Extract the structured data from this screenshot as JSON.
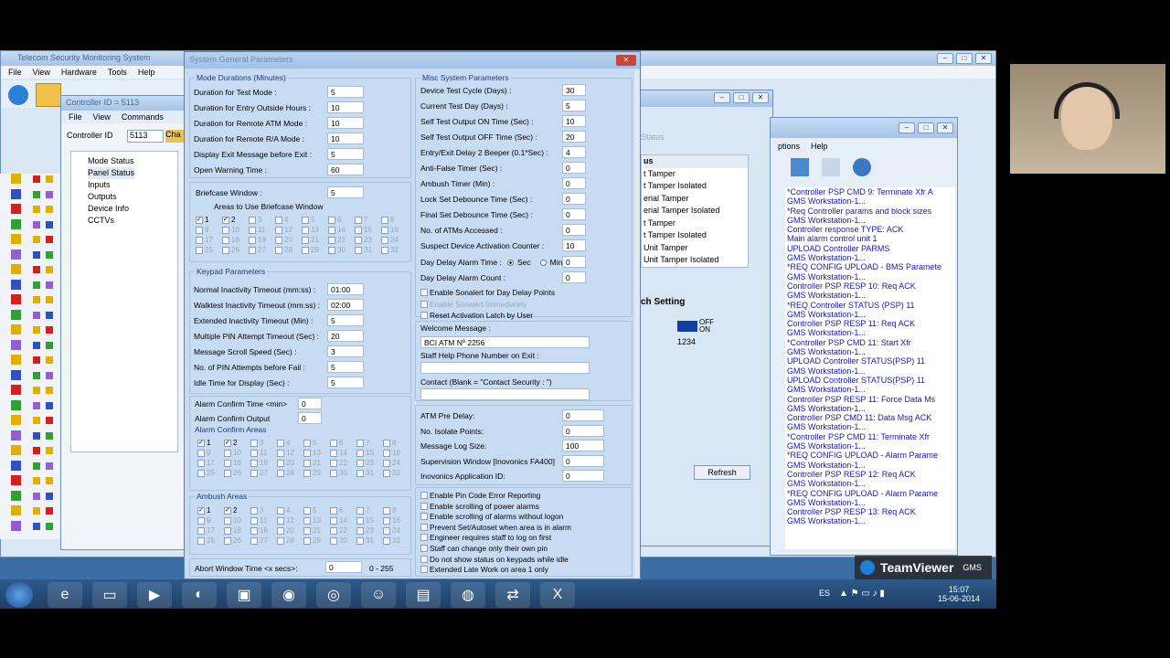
{
  "bg_window": {
    "title": "Telecom Security Monitoring System",
    "menu": [
      "File",
      "View",
      "Hardware",
      "Tools",
      "Help"
    ]
  },
  "controller_window": {
    "title": "Controller ID = 5113",
    "menu": [
      "File",
      "View",
      "Commands"
    ],
    "controller_id_label": "Controller ID",
    "controller_id_value": "5113",
    "cha_button": "Cha",
    "tree": [
      "Mode Status",
      "Panel Status",
      "Inputs",
      "Outputs",
      "Device Info",
      "CCTVs"
    ]
  },
  "status_window": {
    "status_label": "Status",
    "menu": [
      "ptions",
      "Help"
    ],
    "list_header": "us",
    "items": [
      "t Tamper",
      "t Tamper Isolated",
      "erial Tamper",
      "erial Tamper Isolated",
      "t Tamper",
      "t Tamper Isolated",
      "Unit Tamper",
      "Unit Tamper Isolated"
    ],
    "switch_title": "ch Setting",
    "switch_off": "OFF",
    "switch_on": "ON",
    "switch_code": "1234",
    "refresh": "Refresh"
  },
  "log_lines": [
    "*Controller PSP CMD 9: Terminate Xfr A",
    "GMS Workstation-1...",
    "*Req Controller params and block sizes",
    "GMS Workstation-1...",
    "Controller response  TYPE: ACK",
    "Main alarm control unit 1",
    "UPLOAD Controller PARMS",
    "GMS Workstation-1...",
    "*REQ CONFIG UPLOAD - BMS Paramete",
    "GMS Workstation-1...",
    "Controller PSP RESP 10: Req ACK",
    "GMS Workstation-1...",
    "*REQ Controller STATUS (PSP) 11",
    "GMS Workstation-1...",
    "Controller PSP RESP 11: Req ACK",
    "GMS Workstation-1...",
    "*Controller PSP CMD 11: Start Xfr",
    "GMS Workstation-1...",
    "UPLOAD Controller STATUS(PSP) 11",
    "GMS Workstation-1...",
    "UPLOAD Controller STATUS(PSP) 11",
    "GMS Workstation-1...",
    "Controller PSP RESP 11: Force Data Ms",
    "GMS Workstation-1...",
    "Controller PSP CMD 11: Data Msg ACK",
    "GMS Workstation-1...",
    "*Controller PSP CMD 11: Terminate Xfr",
    "GMS Workstation-1...",
    "*REQ CONFIG UPLOAD - Alarm Parame",
    "GMS Workstation-1...",
    "Controller PSP RESP 12: Req ACK",
    "GMS Workstation-1...",
    "*REQ CONFIG UPLOAD - Alarm Parame",
    "GMS Workstation-1...",
    "Controller PSP RESP 13: Req ACK",
    "GMS Workstation-1..."
  ],
  "dialog": {
    "title": "System General Parameters",
    "mode": {
      "title": "Mode Durations (Minutes)",
      "rows": [
        [
          "Duration for Test Mode :",
          "5"
        ],
        [
          "Duration for Entry Outside Hours :",
          "10"
        ],
        [
          "Duration for Remote ATM Mode :",
          "10"
        ],
        [
          "Duration for Remote R/A Mode :",
          "10"
        ],
        [
          "Display Exit Message before Exit :",
          "5"
        ],
        [
          "Open Warning Time :",
          "60"
        ]
      ]
    },
    "briefcase": {
      "label": "Briefcase Window :",
      "value": "5",
      "areas_label": "Areas to Use Briefcase Window"
    },
    "keypad": {
      "title": "Keypad Parameters",
      "rows": [
        [
          "Normal Inactivity Timeout (mm:ss) :",
          "01:00"
        ],
        [
          "Walktest Inactivity Timeout (mm:ss) :",
          "02:00"
        ],
        [
          "Extended Inactivity Timeout (Min) :",
          "5"
        ],
        [
          "Multiple PIN Attempt Timeout (Sec) :",
          "20"
        ],
        [
          "Message Scroll Speed (Sec) :",
          "3"
        ],
        [
          "No. of PIN Attempts before Fail :",
          "5"
        ],
        [
          "Idle Time for Display (Sec) :",
          "5"
        ]
      ]
    },
    "alarm": {
      "confirm_time_label": "Alarm Confirm Time <min>",
      "confirm_time": "0",
      "confirm_output_label": "Alarm Confirm Output",
      "confirm_output": "0",
      "areas_title": "Alarm Confirm Areas"
    },
    "ambush": {
      "title": "Ambush Areas"
    },
    "abort": {
      "label": "Abort Window Time <x secs>:",
      "value": "0",
      "range": "0 - 255"
    },
    "misc": {
      "title": "Misc System Parameters",
      "rows": [
        [
          "Device Test Cycle (Days) :",
          "30"
        ],
        [
          "Current Test Day (Days) :",
          "5"
        ],
        [
          "Self Test Output ON Time (Sec) :",
          "10"
        ],
        [
          "Self Test Output OFF Time (Sec) :",
          "20"
        ],
        [
          "Entry/Exit Delay 2 Beeper (0.1*Sec) :",
          "4"
        ],
        [
          "Anti-False Timer (Sec) :",
          "0"
        ],
        [
          "Ambush Timer (Min) :",
          "0"
        ],
        [
          "Lock Set Debounce Time (Sec) :",
          "0"
        ],
        [
          "Final Set Debounce Time (Sec) :",
          "0"
        ],
        [
          "No. of ATMs Accessed :",
          "0"
        ],
        [
          "Suspect Device Activation Counter :",
          "10"
        ]
      ],
      "day_delay_label": "Day Delay Alarm Time :",
      "sec": "Sec",
      "min": "Min",
      "day_delay_value": "0",
      "count_label": "Day Delay Alarm Count :",
      "count_value": "0",
      "checks": [
        "Enable Sonalert for Day Delay Points",
        "Enable Sonalert Immediately",
        "Reset Activation Latch by User"
      ]
    },
    "welcome": {
      "label": "Welcome Message :",
      "value": "BCI ATM Nº 2256",
      "help_label": "Staff Help Phone Number on Exit :",
      "contact_label": "Contact (Blank = \"Contact Security : \")"
    },
    "atm": {
      "rows": [
        [
          "ATM Pre Delay:",
          "0"
        ],
        [
          "No. Isolate Points:",
          "0"
        ],
        [
          "Message Log Size:",
          "100"
        ],
        [
          "Supervision Window [Inovonics FA400]",
          "0"
        ],
        [
          "Inovonics Application ID:",
          "0"
        ]
      ]
    },
    "options": [
      "Enable Pin Code Error Reporting",
      "Enable scrolling of power alarms",
      "Enable scrolling of alarms without logon",
      "Prevent Set/Autoset when area is in alarm",
      "Engineer requires staff to log on first",
      "Staff can change only their own pin",
      "Do not show status on keypads while idle",
      "Extended Late Work on area 1 only"
    ]
  },
  "taskbar": {
    "lang": "ES",
    "time": "15:07",
    "date": "15-06-2014"
  },
  "teamviewer": {
    "label": "TeamViewer",
    "gms": "GMS"
  }
}
